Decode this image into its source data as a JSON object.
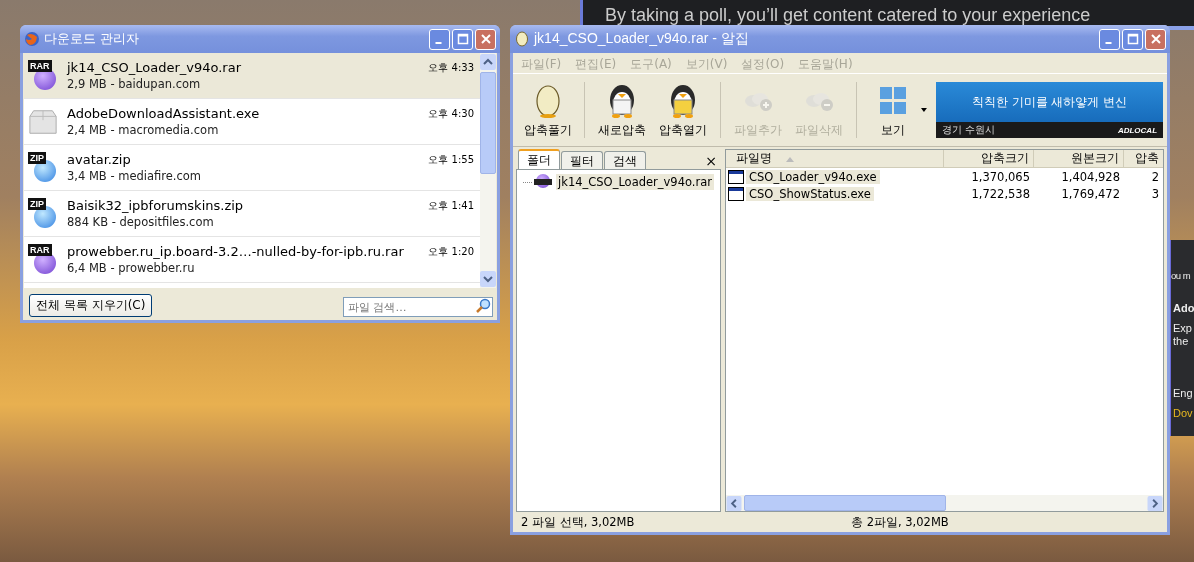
{
  "background_window": {
    "headline": "By taking a poll, you’ll get content catered to your experience",
    "side_texts": [
      "ou m",
      "Ado",
      "Exp",
      "the",
      "Eng",
      "Dov"
    ]
  },
  "download_manager": {
    "title": "다운로드 관리자",
    "items": [
      {
        "kind": "rar",
        "icon_label": "RAR",
        "name": "jk14_CSO_Loader_v94o.rar",
        "details": "2,9 MB - baidupan.com",
        "time": "오후 4:33",
        "selected": true
      },
      {
        "kind": "exe",
        "name": "AdobeDownloadAssistant.exe",
        "details": "2,4 MB - macromedia.com",
        "time": "오후 4:30",
        "selected": false
      },
      {
        "kind": "zip",
        "icon_label": "ZIP",
        "name": "avatar.zip",
        "details": "3,4 MB - mediafire.com",
        "time": "오후 1:55",
        "selected": false
      },
      {
        "kind": "zip",
        "icon_label": "ZIP",
        "name": "Baisik32_ipbforumskins.zip",
        "details": "884 KB - depositfiles.com",
        "time": "오후 1:41",
        "selected": false
      },
      {
        "kind": "rar",
        "icon_label": "RAR",
        "name": "prowebber.ru_ip.board-3.2…-nulled-by-for-ipb.ru.rar",
        "details": "6,4 MB - prowebber.ru",
        "time": "오후 1:20",
        "selected": false
      }
    ],
    "clear_button": "전체 목록 지우기(C)",
    "search": {
      "placeholder": "파일 검색…"
    }
  },
  "alzip": {
    "title": "jk14_CSO_Loader_v94o.rar - 알집",
    "menu": [
      "파일(F)",
      "편집(E)",
      "도구(A)",
      "보기(V)",
      "설정(O)",
      "도움말(H)"
    ],
    "toolbar": [
      {
        "kind": "egg",
        "label": "압축풀기",
        "disabled": false
      },
      {
        "kind": "penguin-paper",
        "label": "새로압축",
        "disabled": false
      },
      {
        "kind": "penguin-folder",
        "label": "압축열기",
        "disabled": false
      },
      {
        "kind": "eggs-plus",
        "label": "파일추가",
        "disabled": true
      },
      {
        "kind": "eggs-minus",
        "label": "파일삭제",
        "disabled": true
      },
      {
        "kind": "grid",
        "label": "보기",
        "disabled": false
      }
    ],
    "ad": {
      "headline": "칙칙한 기미를 새하얗게 변신",
      "location": "경기 수원시",
      "brand": "ADLOCAL"
    },
    "tabs": [
      {
        "label": "폴더",
        "selected": true
      },
      {
        "label": "필터",
        "selected": false
      },
      {
        "label": "검색",
        "selected": false
      }
    ],
    "close_pane": "×",
    "tree": [
      {
        "label": "jk14_CSO_Loader_v94o.rar",
        "selected": true
      }
    ],
    "columns": [
      "파일명",
      "압축크기",
      "원본크기",
      "압축"
    ],
    "rows": [
      {
        "name": "CSO_Loader_v94o.exe",
        "packed": "1,370,065",
        "original": "1,404,928",
        "column_4": "2",
        "selected": true
      },
      {
        "name": "CSO_ShowStatus.exe",
        "packed": "1,722,538",
        "original": "1,769,472",
        "column_4": "3",
        "selected": true
      }
    ],
    "status_left": "2 파일 선택,  3,02MB",
    "status_right": "총 2파일,  3,02MB"
  }
}
